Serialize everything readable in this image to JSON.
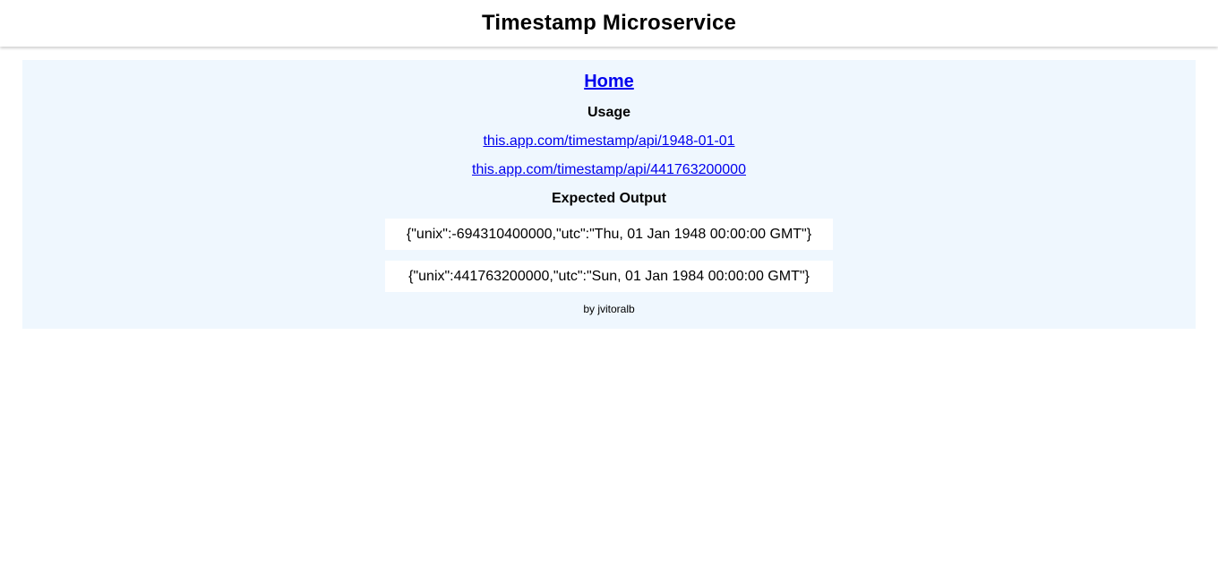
{
  "header": {
    "title": "Timestamp Microservice"
  },
  "main": {
    "home_link": "Home",
    "usage_title": "Usage",
    "usage_links": [
      "this.app.com/timestamp/api/1948-01-01",
      "this.app.com/timestamp/api/441763200000"
    ],
    "expected_title": "Expected Output",
    "outputs": [
      "{\"unix\":-694310400000,\"utc\":\"Thu, 01 Jan 1948 00:00:00 GMT\"}",
      "{\"unix\":441763200000,\"utc\":\"Sun, 01 Jan 1984 00:00:00 GMT\"}"
    ],
    "footer": "by jvitoralb"
  },
  "colors": {
    "panel_background": "#eff7fe",
    "link": "#0000ee"
  }
}
